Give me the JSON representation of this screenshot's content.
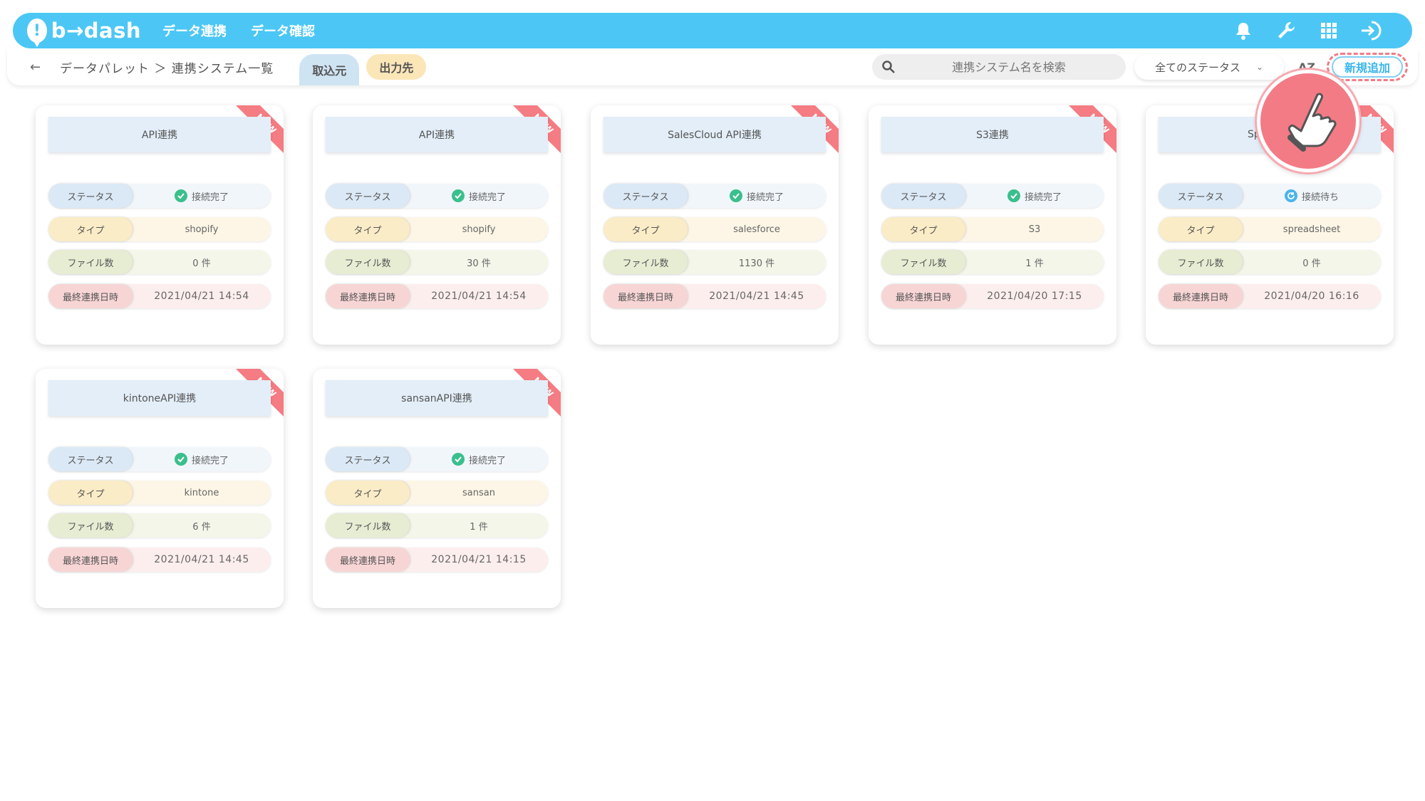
{
  "header": {
    "logo_text": "b→dash",
    "nav": [
      "データ連携",
      "データ確認"
    ]
  },
  "subbar": {
    "back_label": "←",
    "breadcrumb": "データパレット ＞ 連携システム一覧",
    "tab_import": "取込元",
    "tab_export": "出力先",
    "search_placeholder": "連携システム名を検索",
    "status_filter": "全てのステータス",
    "sort_label": "AZ",
    "add_label": "新規追加"
  },
  "labels": {
    "status": "ステータス",
    "type": "タイプ",
    "files": "ファイル数",
    "last": "最終連携日時",
    "new_badge": "NEW"
  },
  "cards": [
    {
      "title": "API連携",
      "status": "接続完了",
      "status_kind": "ok",
      "type": "shopify",
      "files": "0 件",
      "last": "2021/04/21 14:54"
    },
    {
      "title": "API連携",
      "status": "接続完了",
      "status_kind": "ok",
      "type": "shopify",
      "files": "30 件",
      "last": "2021/04/21 14:54"
    },
    {
      "title": "SalesCloud API連携",
      "status": "接続完了",
      "status_kind": "ok",
      "type": "salesforce",
      "files": "1130 件",
      "last": "2021/04/21 14:45"
    },
    {
      "title": "S3連携",
      "status": "接続完了",
      "status_kind": "ok",
      "type": "S3",
      "files": "1 件",
      "last": "2021/04/20 17:15"
    },
    {
      "title": "SpreadSl",
      "status": "接続待ち",
      "status_kind": "wait",
      "type": "spreadsheet",
      "files": "0 件",
      "last": "2021/04/20 16:16"
    },
    {
      "title": "kintoneAPI連携",
      "status": "接続完了",
      "status_kind": "ok",
      "type": "kintone",
      "files": "6 件",
      "last": "2021/04/21 14:45"
    },
    {
      "title": "sansanAPI連携",
      "status": "接続完了",
      "status_kind": "ok",
      "type": "sansan",
      "files": "1 件",
      "last": "2021/04/21 14:15"
    }
  ]
}
